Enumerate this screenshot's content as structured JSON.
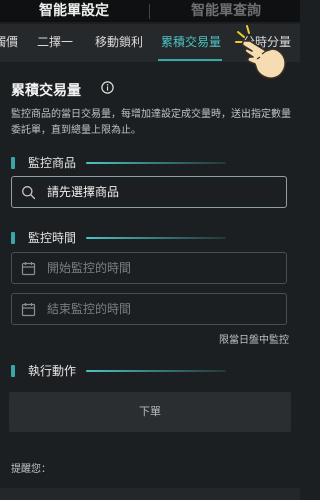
{
  "header": {
    "tab_active": "智能單設定",
    "tab_inactive": "智能單查詢"
  },
  "subtabs": {
    "items": [
      "觸價",
      "二擇一",
      "移動鎖利",
      "累積交易量",
      "分時分量"
    ],
    "active": "累積交易量"
  },
  "section": {
    "title": "累積交易量",
    "description": "監控商品的當日交易量，每增加達設定成交量時，送出指定數量委託單，直到總量上限為止。"
  },
  "monitor_product": {
    "label": "監控商品",
    "placeholder": "請先選擇商品"
  },
  "monitor_time": {
    "label": "監控時間",
    "start_placeholder": "開始監控的時間",
    "end_placeholder": "結束監控的時間",
    "note": "限當日盤中監控"
  },
  "action": {
    "label": "執行動作",
    "button": "下單"
  },
  "reminder": {
    "label": "提醒您："
  },
  "colors": {
    "accent": "#3aa7a7",
    "background": "#1c1f21",
    "tab_bar": "#25292b"
  }
}
